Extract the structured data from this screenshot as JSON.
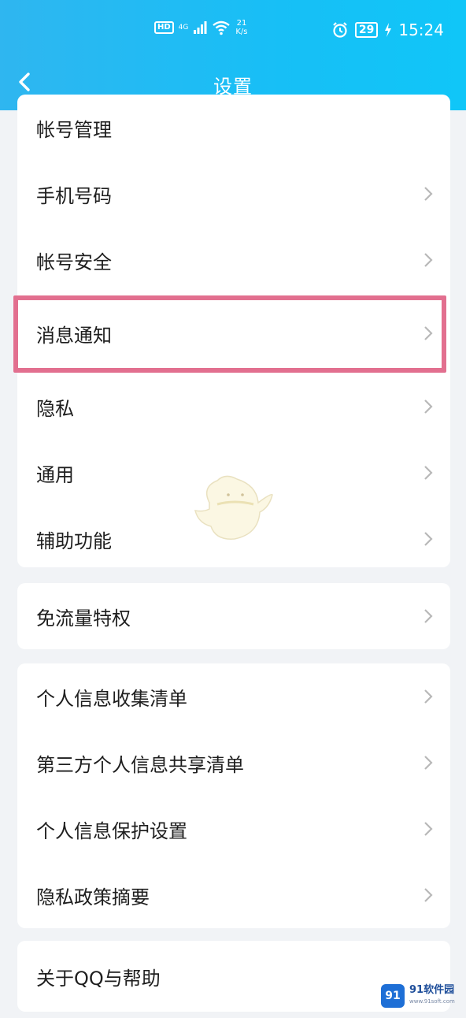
{
  "status_bar": {
    "hd": "HD",
    "net": "4G",
    "speed_value": "21",
    "speed_unit": "K/s",
    "battery": "29",
    "time": "15:24"
  },
  "nav": {
    "title": "设置"
  },
  "groups": [
    {
      "items": [
        {
          "label": "帐号管理",
          "chevron": false
        },
        {
          "label": "手机号码",
          "chevron": true
        },
        {
          "label": "帐号安全",
          "chevron": true
        },
        {
          "label": "消息通知",
          "chevron": true,
          "highlighted": true
        },
        {
          "label": "隐私",
          "chevron": true
        },
        {
          "label": "通用",
          "chevron": true
        },
        {
          "label": "辅助功能",
          "chevron": true
        }
      ]
    },
    {
      "items": [
        {
          "label": "免流量特权",
          "chevron": true
        }
      ]
    },
    {
      "items": [
        {
          "label": "个人信息收集清单",
          "chevron": true
        },
        {
          "label": "第三方个人信息共享清单",
          "chevron": true
        },
        {
          "label": "个人信息保护设置",
          "chevron": true
        },
        {
          "label": "隐私政策摘要",
          "chevron": true
        }
      ]
    },
    {
      "items": [
        {
          "label": "关于QQ与帮助",
          "chevron": false
        }
      ]
    }
  ],
  "watermark": {
    "logo_text": "91",
    "name": "91软件园",
    "url": "www.91soft.com"
  },
  "colors": {
    "header": "#17bff6",
    "highlight": "#e26f8f"
  }
}
